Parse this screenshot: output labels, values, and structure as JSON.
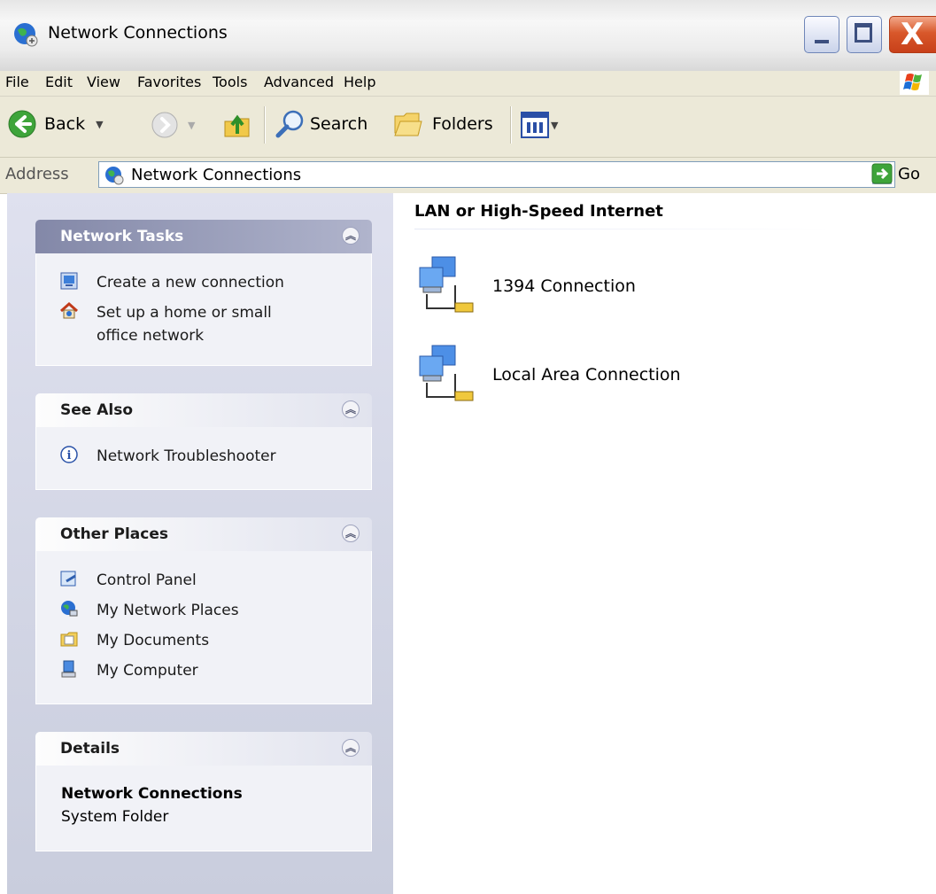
{
  "window": {
    "title": "Network Connections",
    "controls": {
      "minimize": "_",
      "maximize": "□",
      "close": "X"
    }
  },
  "menu": [
    "File",
    "Edit",
    "View",
    "Favorites",
    "Tools",
    "Advanced",
    "Help"
  ],
  "toolbar": {
    "back_label": "Back",
    "search_label": "Search",
    "folders_label": "Folders"
  },
  "address": {
    "label": "Address",
    "value": "Network Connections",
    "go_label": "Go"
  },
  "sidebar": {
    "network_tasks": {
      "title": "Network Tasks",
      "items": [
        "Create a new connection",
        "Set up a home or small office network"
      ]
    },
    "see_also": {
      "title": "See Also",
      "items": [
        "Network Troubleshooter"
      ]
    },
    "other_places": {
      "title": "Other Places",
      "items": [
        "Control Panel",
        "My Network Places",
        "My Documents",
        "My Computer"
      ]
    },
    "details": {
      "title": "Details",
      "name": "Network Connections",
      "type": "System Folder"
    }
  },
  "main": {
    "group_title": "LAN or High-Speed Internet",
    "connections": [
      "1394 Connection",
      "Local Area Connection"
    ]
  },
  "colors": {
    "xp_blue_accent": "#3c4f7f",
    "close_button": "#d8582a",
    "sidebar_bg": "#d5d8e6",
    "menubar_bg": "#ece9d8"
  },
  "icons": {
    "app": "network-connections-globe-icon",
    "back": "back-arrow-icon",
    "forward": "forward-arrow-icon",
    "up": "up-folder-icon",
    "search": "search-magnifier-icon",
    "folders": "folders-icon",
    "views": "views-grid-icon",
    "go": "go-arrow-icon",
    "connection": "lan-connection-icon"
  }
}
